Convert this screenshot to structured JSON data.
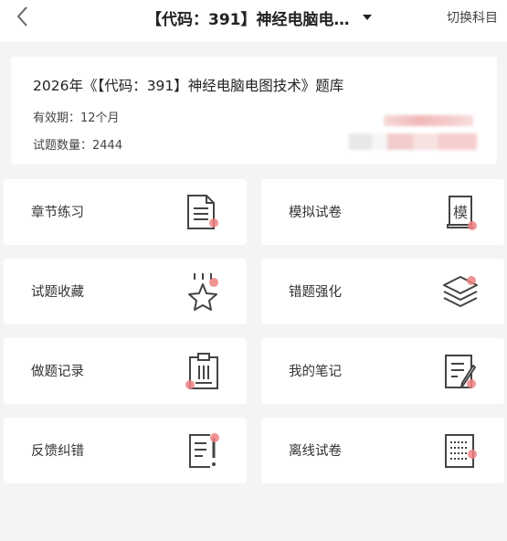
{
  "header": {
    "title": "【代码：391】神经电脑电…",
    "switch_label": "切换科目",
    "back_icon": "back-arrow-icon",
    "dropdown_icon": "caret-down-icon"
  },
  "info": {
    "title": "2026年《【代码：391】神经电脑电图技术》题库",
    "validity": "有效期：12个月",
    "question_count": "试题数量：2444"
  },
  "accent_color": "#f08080",
  "tiles": [
    {
      "label": "章节练习",
      "icon": "document-icon"
    },
    {
      "label": "模拟试卷",
      "icon": "exam-scroll-icon",
      "icon_text": "模"
    },
    {
      "label": "试题收藏",
      "icon": "star-icon"
    },
    {
      "label": "错题强化",
      "icon": "layers-icon"
    },
    {
      "label": "做题记录",
      "icon": "clipboard-icon"
    },
    {
      "label": "我的笔记",
      "icon": "note-pencil-icon"
    },
    {
      "label": "反馈纠错",
      "icon": "feedback-icon"
    },
    {
      "label": "离线试卷",
      "icon": "offline-paper-icon"
    }
  ]
}
